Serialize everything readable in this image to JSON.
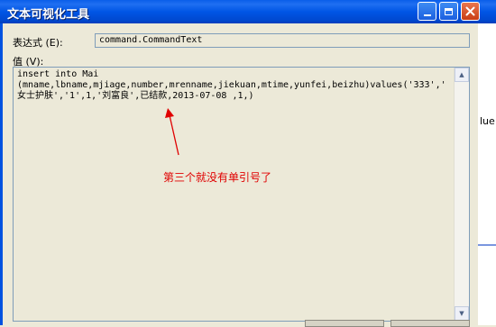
{
  "window": {
    "title": "文本可视化工具",
    "controls": [
      "minimize-icon",
      "maximize-icon",
      "close-icon"
    ]
  },
  "expression": {
    "label": "表达式 (E):",
    "value": "command.CommandText"
  },
  "value_field": {
    "label": "值 (V):",
    "text": "insert into Mai\n(mname,lbname,mjiage,number,mrenname,jiekuan,mtime,yunfei,beizhu)values('333','\n女士护肤','1',1,'刘富良',已结款,2013-07-08 ,1,)"
  },
  "annotation": {
    "text": "第三个就没有单引号了",
    "color": "#e00000"
  },
  "background_window": {
    "partial_text": "lue"
  },
  "colors": {
    "titlebar": "#0055e5",
    "face": "#ece9d8",
    "close_button": "#c93d15"
  }
}
